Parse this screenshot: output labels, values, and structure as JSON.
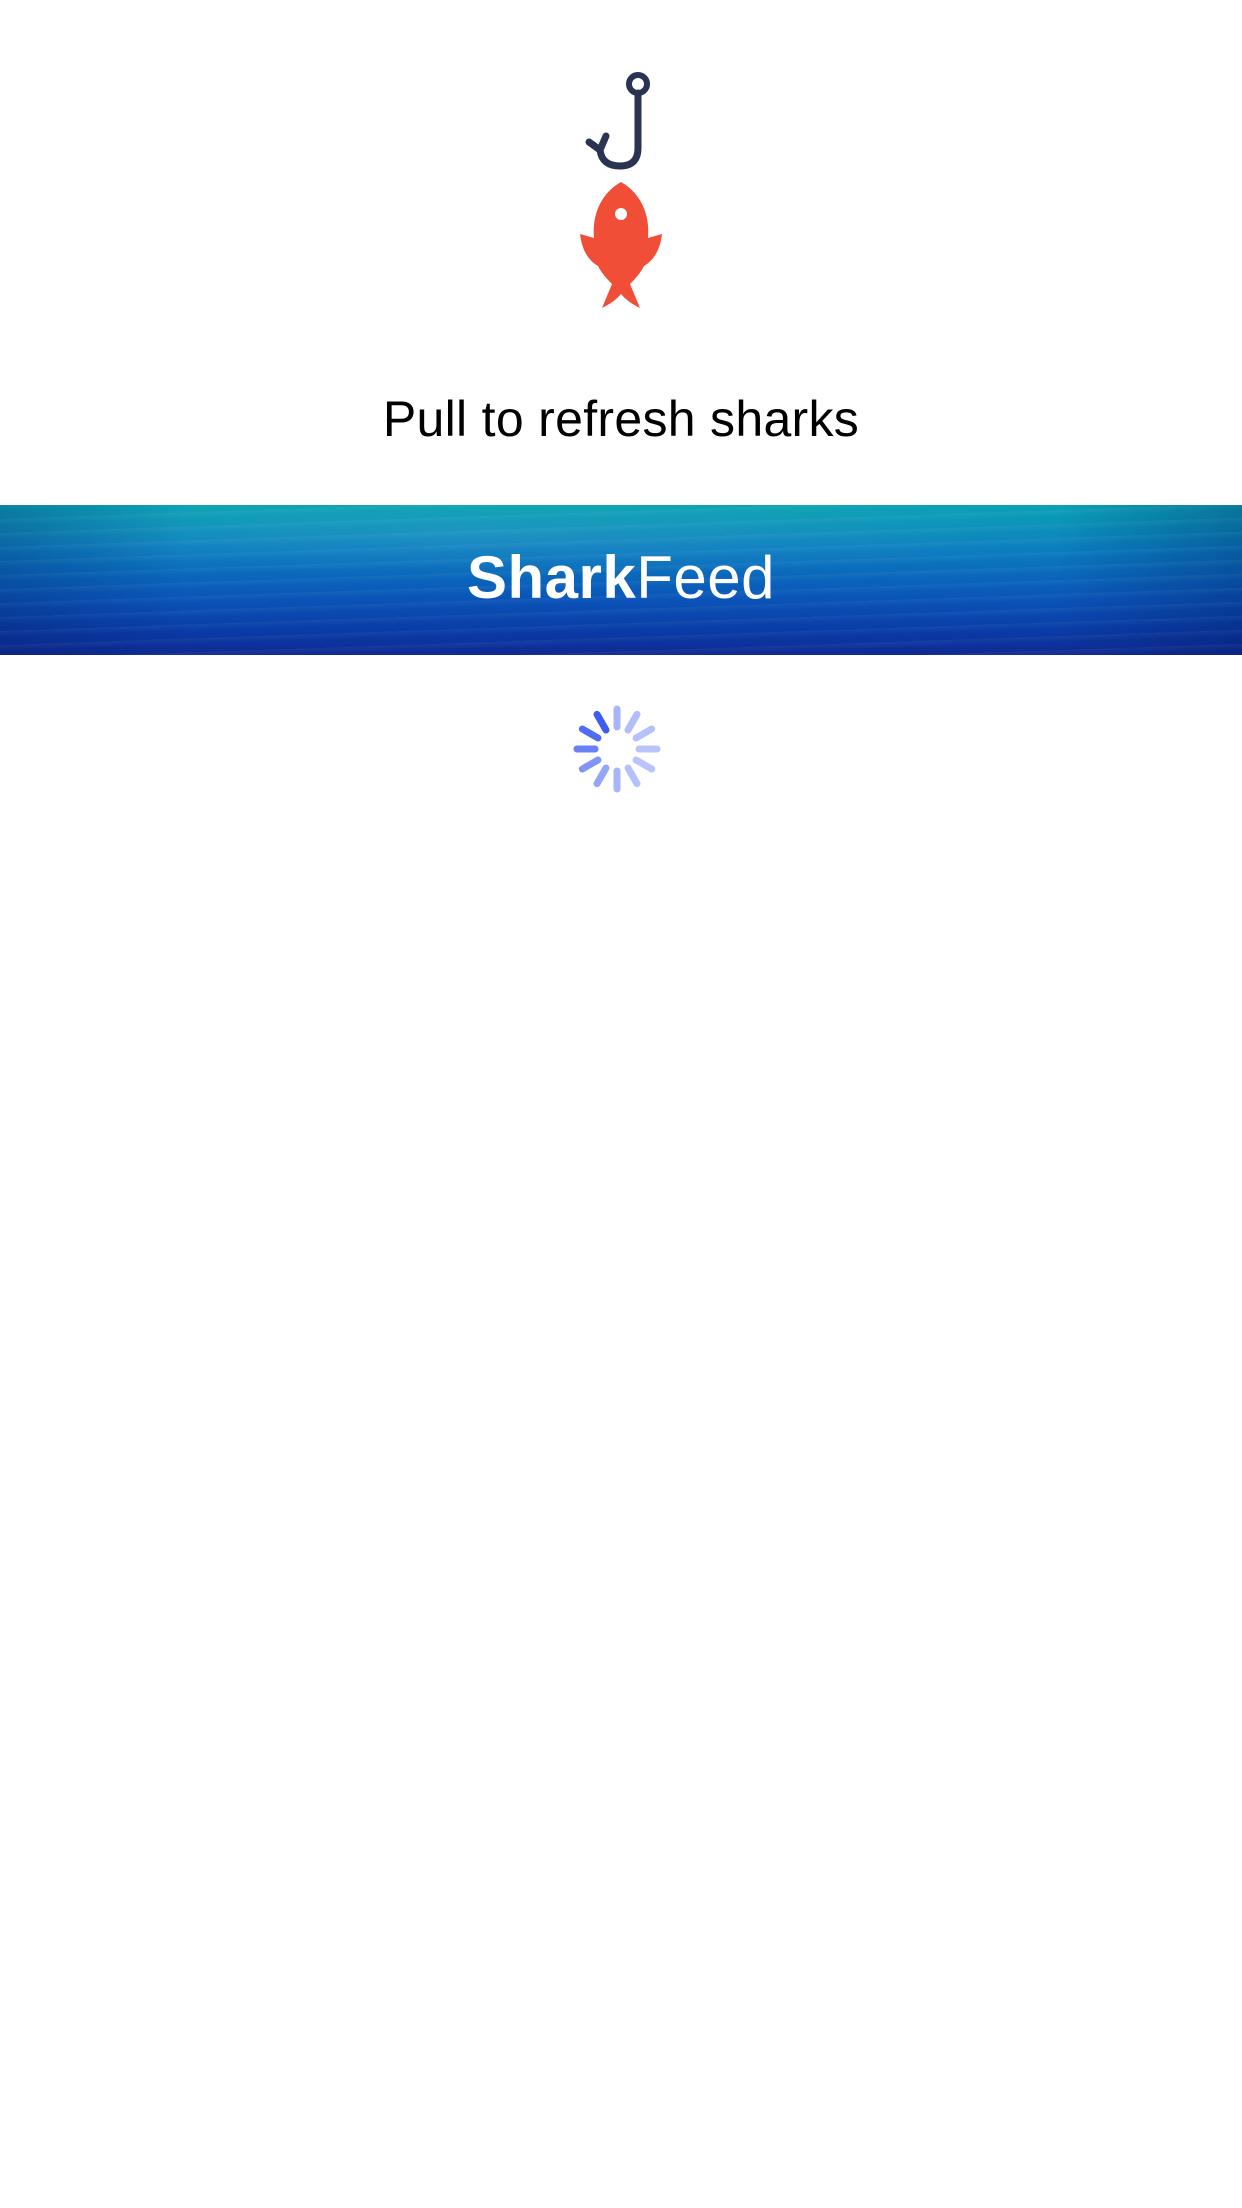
{
  "refresh": {
    "label": "Pull to refresh sharks"
  },
  "navbar": {
    "brand_bold": "Shark",
    "brand_light": "Feed"
  },
  "icons": {
    "hook": "fishing-hook-icon",
    "fish": "fish-icon",
    "spinner": "activity-spinner-icon"
  },
  "colors": {
    "hook": "#2a3352",
    "fish": "#f04e37",
    "spinner": "#3d5cf0",
    "nav_top": "#0aa3b3",
    "nav_bottom": "#102a92"
  }
}
